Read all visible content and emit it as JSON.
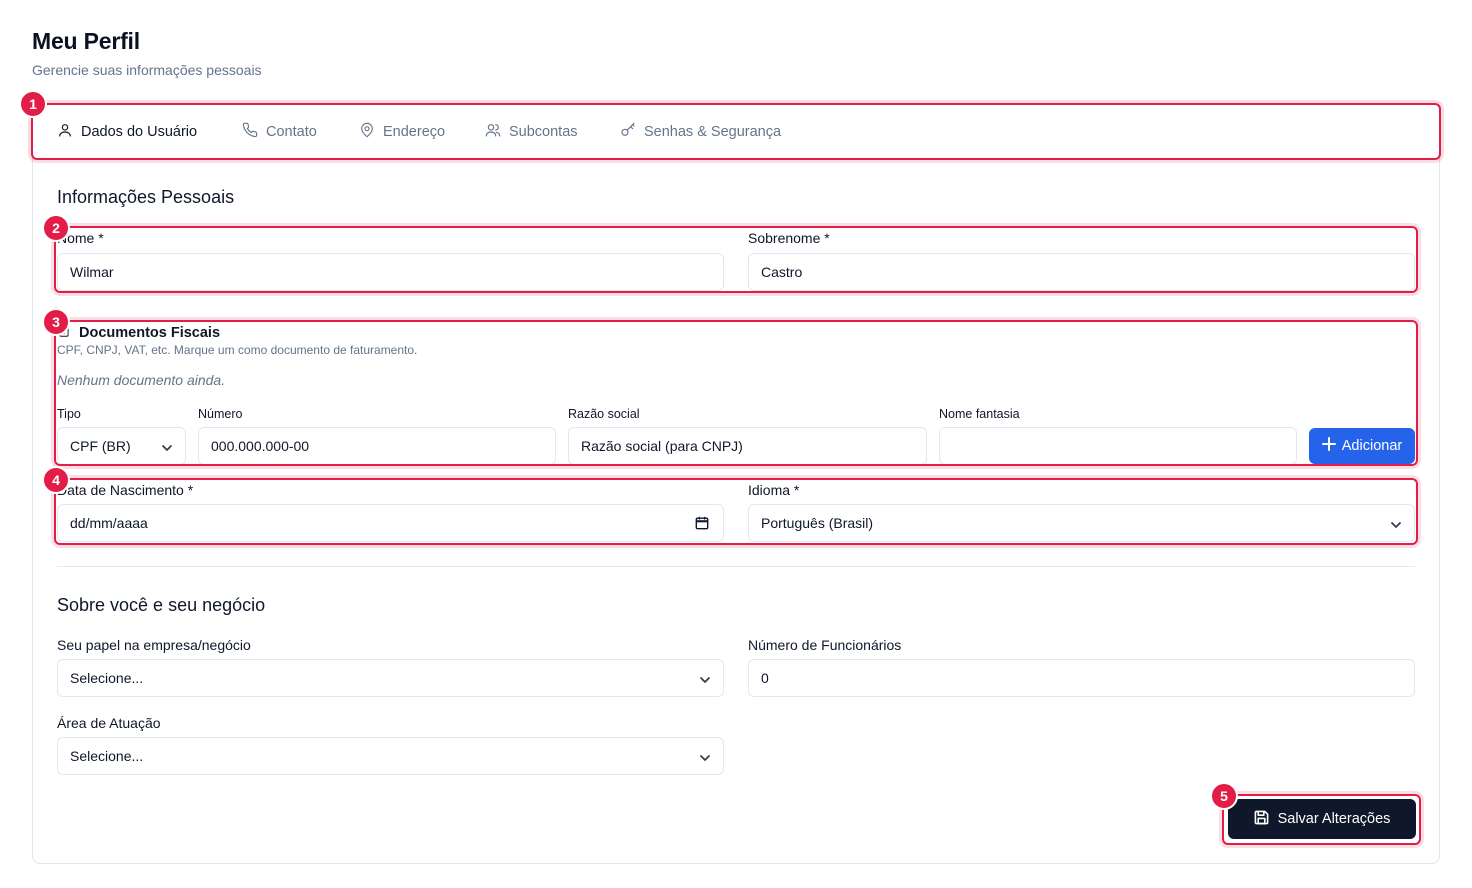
{
  "header": {
    "title": "Meu Perfil",
    "subtitle": "Gerencie suas informações pessoais"
  },
  "tabs": [
    {
      "label": "Dados do Usuário",
      "icon": "user-icon",
      "active": true
    },
    {
      "label": "Contato",
      "icon": "phone-icon",
      "active": false
    },
    {
      "label": "Endereço",
      "icon": "map-pin-icon",
      "active": false
    },
    {
      "label": "Subcontas",
      "icon": "users-icon",
      "active": false
    },
    {
      "label": "Senhas & Segurança",
      "icon": "key-icon",
      "active": false
    }
  ],
  "personal": {
    "section_title": "Informações Pessoais",
    "first_name_label": "Nome *",
    "first_name_value": "Wilmar",
    "last_name_label": "Sobrenome *",
    "last_name_value": "Castro"
  },
  "documents": {
    "title": "Documentos Fiscais",
    "hint": "CPF, CNPJ, VAT, etc. Marque um como documento de faturamento.",
    "empty_text": "Nenhum documento ainda.",
    "type_label": "Tipo",
    "type_value": "CPF (BR)",
    "number_label": "Número",
    "number_placeholder": "000.000.000-00",
    "company_label": "Razão social",
    "company_placeholder": "Razão social (para CNPJ)",
    "trade_name_label": "Nome fantasia",
    "trade_name_value": "",
    "add_button": "Adicionar"
  },
  "birth_language": {
    "birth_label": "Data de Nascimento *",
    "birth_placeholder": "dd/mm/aaaa",
    "language_label": "Idioma *",
    "language_value": "Português (Brasil)"
  },
  "business": {
    "section_title": "Sobre você e seu negócio",
    "role_label": "Seu papel na empresa/negócio",
    "role_value": "Selecione...",
    "employees_label": "Número de Funcionários",
    "employees_value": "0",
    "area_label": "Área de Atuação",
    "area_value": "Selecione..."
  },
  "actions": {
    "save_button": "Salvar Alterações"
  },
  "annotations": [
    "1",
    "2",
    "3",
    "4",
    "5"
  ],
  "colors": {
    "accent": "#2563eb",
    "annotation": "#e11d48",
    "dark_button": "#0f172a"
  }
}
